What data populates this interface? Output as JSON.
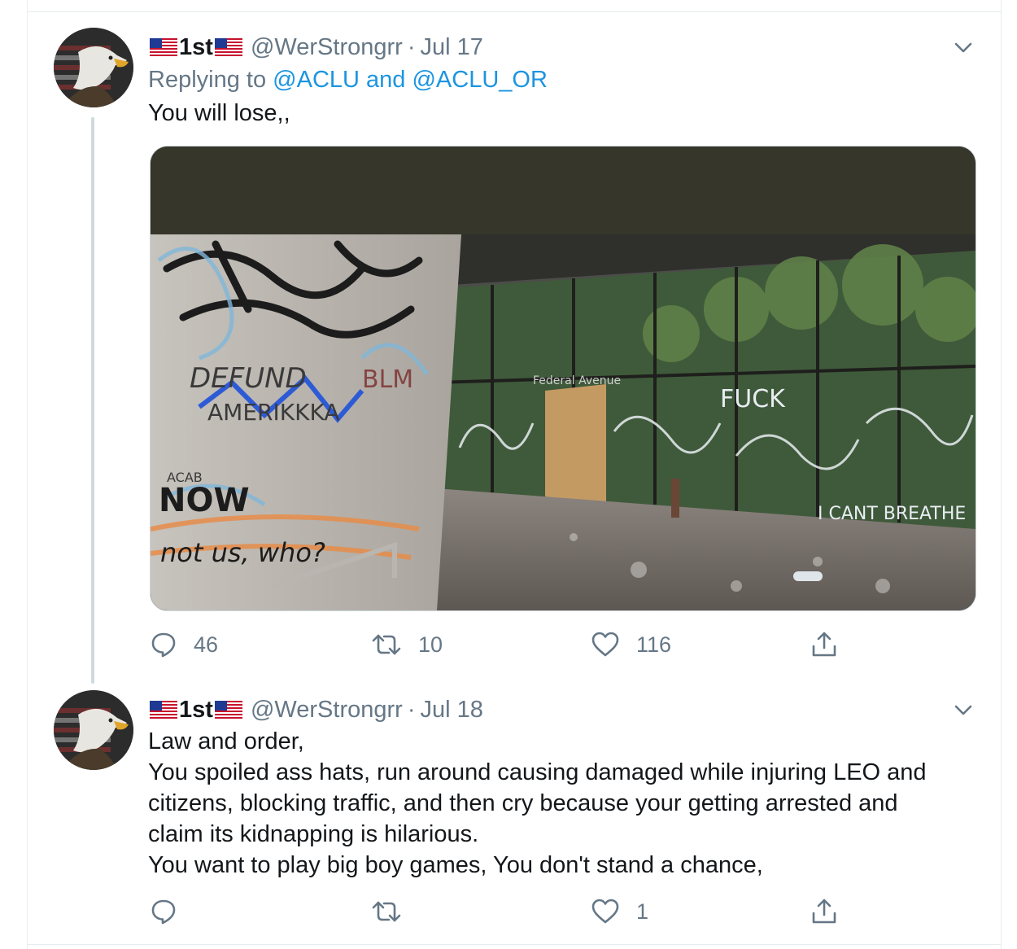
{
  "thread": {
    "tweets": [
      {
        "display_name": "1st",
        "flag_icon": "us-flag-icon",
        "handle": "@WerStrongrr",
        "dot": "·",
        "date": "Jul 17",
        "replying_prefix": "Replying to",
        "replying_users": [
          "@ACLU",
          "@ACLU_OR"
        ],
        "replying_joiner": "and",
        "text_lines": [
          "You will lose,,"
        ],
        "media": {
          "description_text": "Federal Avenue",
          "graffiti": [
            "DEFUND",
            "AMERIKKKA",
            "NOW",
            "not us, who?",
            "FUCK",
            "ACAB",
            "I CANT BREATHE",
            "BLM"
          ]
        },
        "stats": {
          "replies": "46",
          "retweets": "10",
          "likes": "116"
        }
      },
      {
        "display_name": "1st",
        "flag_icon": "us-flag-icon",
        "handle": "@WerStrongrr",
        "dot": "·",
        "date": "Jul 18",
        "text_lines": [
          "Law and order,",
          "You spoiled ass hats, run around causing damaged while injuring LEO and",
          "citizens, blocking traffic, and then cry because your getting arrested and",
          "claim its kidnapping is hilarious.",
          "You want to play big boy games, You don't stand a chance,"
        ],
        "stats": {
          "replies": "",
          "retweets": "",
          "likes": "1"
        }
      }
    ]
  },
  "colors": {
    "text": "#14171a",
    "muted": "#657786",
    "link": "#1b95e0",
    "border": "#e6ecf0",
    "thread_line": "#cfd9de"
  },
  "icons": {
    "reply": "reply-icon",
    "retweet": "retweet-icon",
    "like": "heart-icon",
    "share": "share-icon",
    "caret": "chevron-down-icon"
  }
}
